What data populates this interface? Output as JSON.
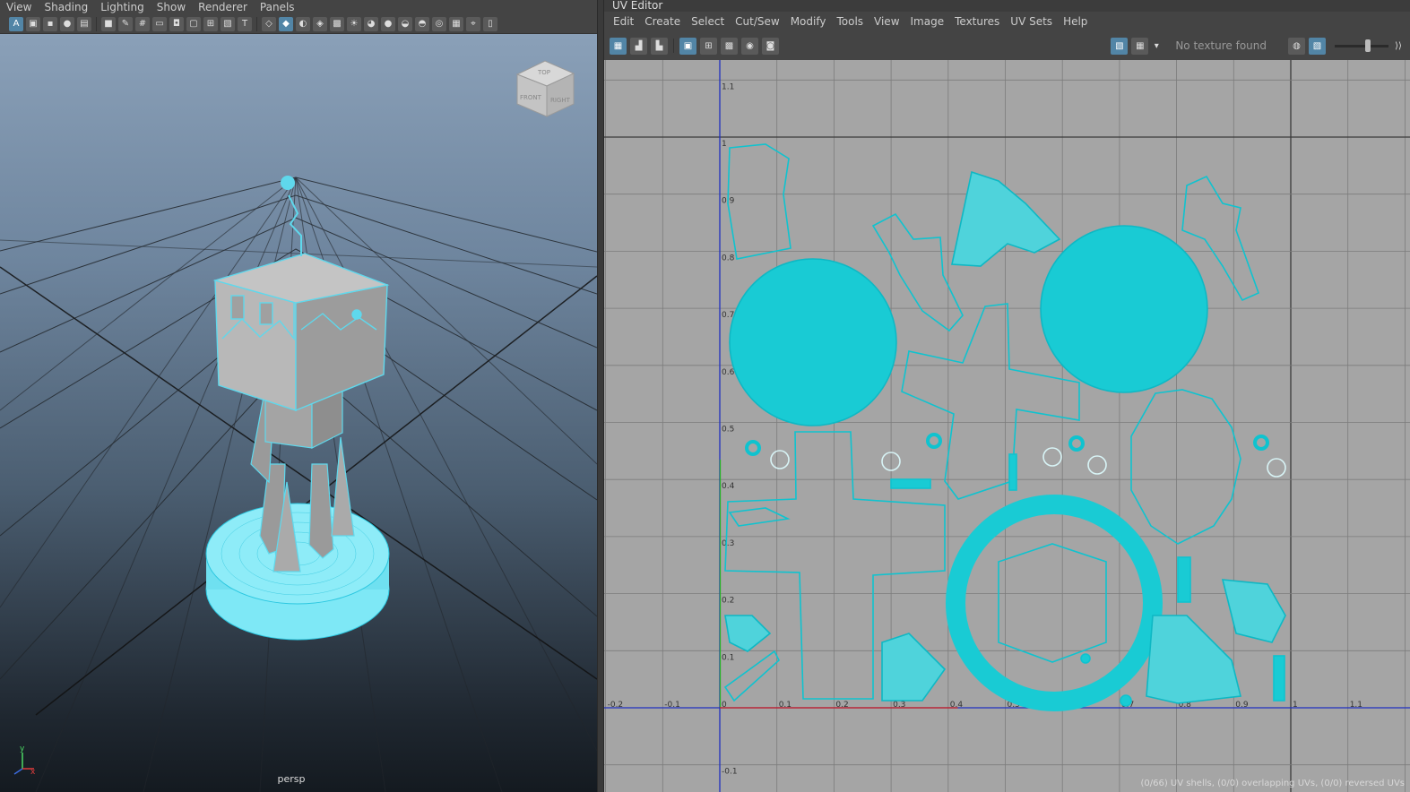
{
  "left": {
    "menu": [
      "View",
      "Shading",
      "Lighting",
      "Show",
      "Renderer",
      "Panels"
    ],
    "camera_label": "persp",
    "viewcube": {
      "top": "TOP",
      "front": "FRONT",
      "right": "RIGHT"
    },
    "axis": {
      "x": "x",
      "y": "y"
    }
  },
  "uv": {
    "title": "UV Editor",
    "menu": [
      "Edit",
      "Create",
      "Select",
      "Cut/Sew",
      "Modify",
      "Tools",
      "View",
      "Image",
      "Textures",
      "UV Sets",
      "Help"
    ],
    "texture_status": "No texture found",
    "status_text": "(0/66) UV shells, (0/0) overlapping UVs, (0/0) reversed UVs",
    "axis_u_labels": [
      "-0.2",
      "-0.1",
      "0",
      "0.1",
      "0.2",
      "0.3",
      "0.4",
      "0.5",
      "0.6",
      "0.7",
      "0.8",
      "0.9",
      "1",
      "1.1"
    ],
    "axis_v_labels": [
      "1.1",
      "1",
      "0.9",
      "0.8",
      "0.7",
      "0.6",
      "0.5",
      "0.4",
      "0.3",
      "0.2",
      "0.1",
      "-0.1"
    ]
  },
  "colors": {
    "uv_shell": "#12c8d2",
    "wireframe": "#5fd8ec",
    "u_axis": "#d02020",
    "v_axis": "#2030c0"
  }
}
